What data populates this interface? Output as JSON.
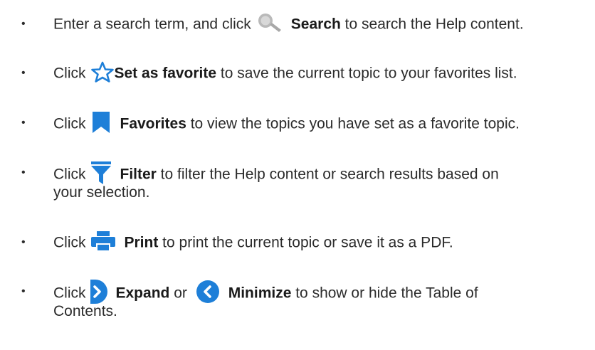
{
  "items": [
    {
      "prefix": "Enter a search term, and click",
      "icon": "magnifier-icon",
      "label": "Search",
      "suffix": " to search the Help content."
    },
    {
      "prefix": "Click",
      "icon": "star-outline-icon",
      "label": "Set as favorite",
      "suffix": " to save the current topic to your favorites list."
    },
    {
      "prefix": "Click",
      "icon": "bookmark-icon",
      "label": "Favorites",
      "suffix": " to view the topics you have set as a favorite topic."
    },
    {
      "prefix": "Click",
      "icon": "filter-funnel-icon",
      "label": "Filter",
      "suffix": " to filter the Help content or search results based on",
      "continuation": "your selection."
    },
    {
      "prefix": "Click",
      "icon": "printer-icon",
      "label": "Print",
      "suffix": " to print the current topic or save it as a PDF."
    },
    {
      "prefix": "Click",
      "icon": "expand-chevron-right-icon",
      "label": "Expand",
      "middle": " or ",
      "icon2": "minimize-chevron-left-icon",
      "label2": "Minimize",
      "suffix": " to show or hide the Table of",
      "continuation": "Contents."
    }
  ],
  "bullet_char": "•",
  "colors": {
    "text": "#2b2b2b",
    "icon_blue": "#1e7fd8",
    "search_gray": "#b4b4b4"
  }
}
